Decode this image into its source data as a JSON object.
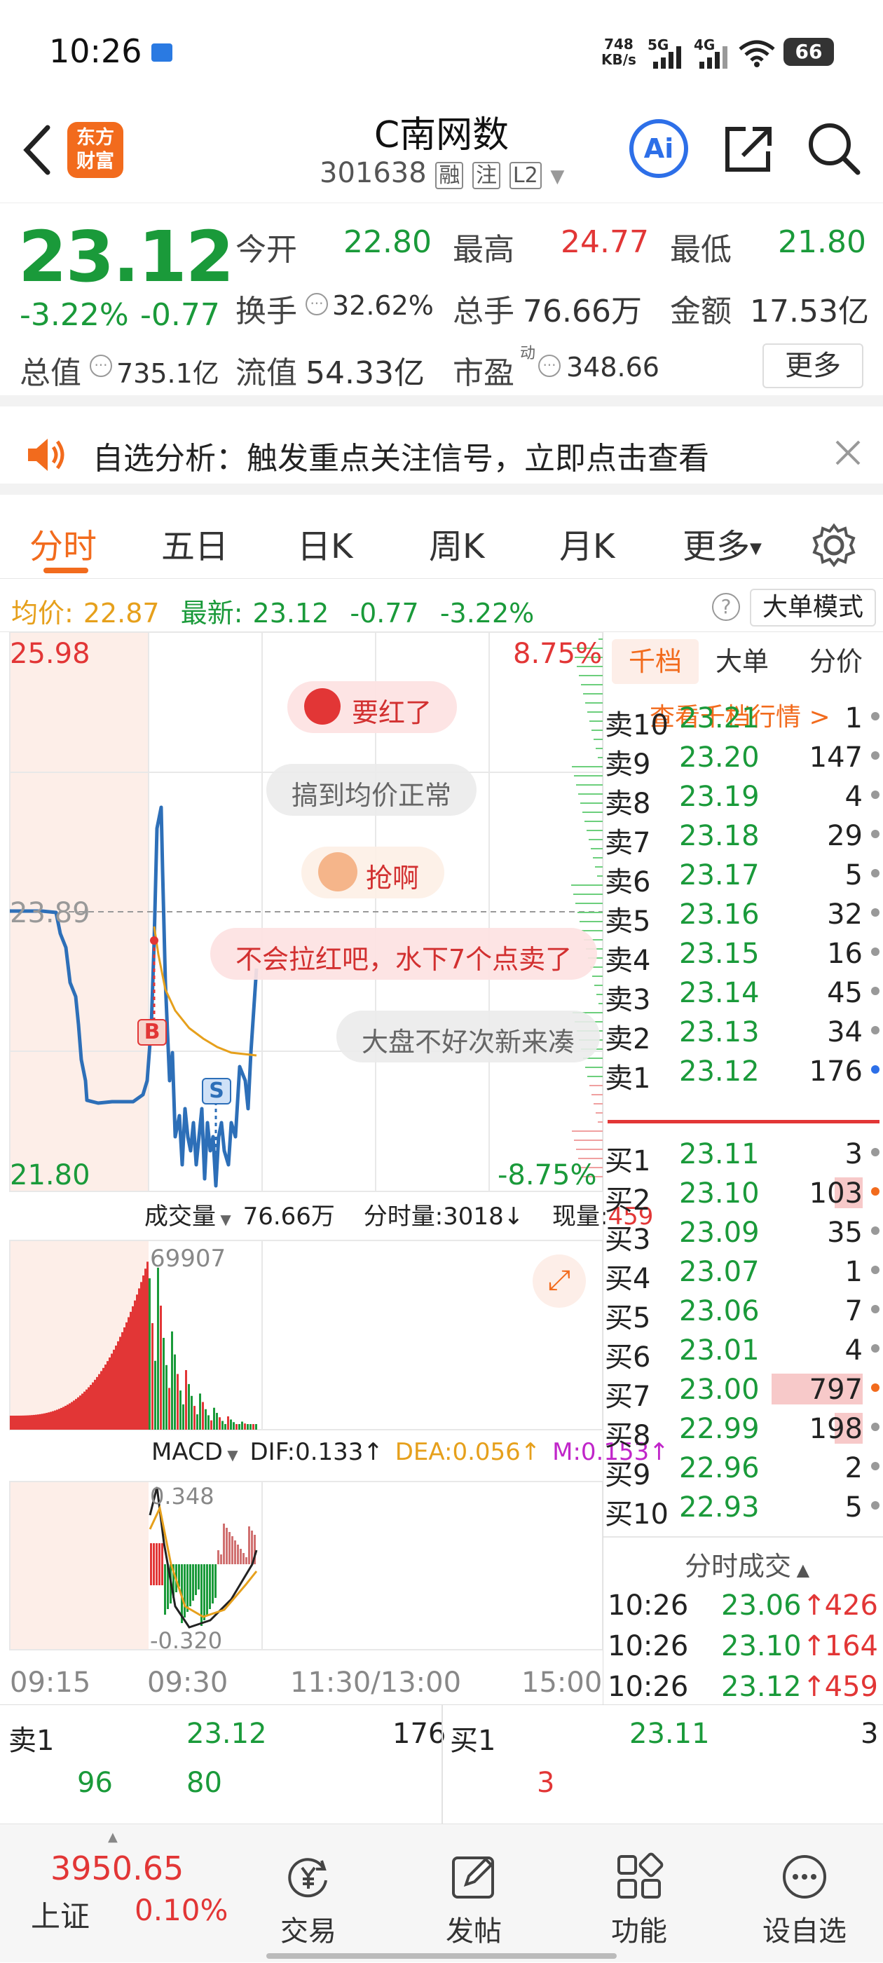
{
  "status": {
    "time": "10:26",
    "net_speed": "748",
    "net_unit": "KB/s",
    "battery": "66"
  },
  "header": {
    "logo_line1": "东方",
    "logo_line2": "财富",
    "title": "C南网数",
    "code": "301638",
    "badges": [
      "融",
      "注",
      "L2"
    ],
    "ai_label": "Ai"
  },
  "quote": {
    "price": "23.12",
    "change_pct": "-3.22%",
    "change": "-0.77",
    "open_label": "今开",
    "open": "22.80",
    "high_label": "最高",
    "high": "24.77",
    "low_label": "最低",
    "low": "21.80",
    "turnover_label": "换手",
    "turnover": "32.62%",
    "volume_label": "总手",
    "volume": "76.66万",
    "amount_label": "金额",
    "amount": "17.53亿",
    "mktcap_label": "总值",
    "mktcap": "735.1亿",
    "float_label": "流值",
    "float": "54.33亿",
    "pe_label": "市盈",
    "pe_sup": "动",
    "pe": "348.66",
    "more_button": "更多"
  },
  "notice": {
    "text": "自选分析：触发重点关注信号，立即点击查看"
  },
  "tabs": [
    "分时",
    "五日",
    "日K",
    "周K",
    "月K",
    "更多"
  ],
  "avgbar": {
    "avg_label": "均价:",
    "avg": "22.87",
    "latest_label": "最新:",
    "latest": "23.12",
    "chg": "-0.77",
    "pct": "-3.22%",
    "mode_button": "大单模式"
  },
  "chart": {
    "top_price": "25.98",
    "mid_price": "23.89",
    "bottom_price": "21.80",
    "top_pct": "8.75%",
    "bottom_pct": "-8.75%",
    "vol_label": "成交量",
    "vol_total": "76.66万",
    "vol_time": "分时量:3018↓",
    "vol_now_label": "现量:",
    "vol_now": "459",
    "vol_max": "69907",
    "macd_label": "MACD",
    "dif": "DIF:0.133↑",
    "dea": "DEA:0.056↑",
    "m": "M:0.153↑",
    "macd_max": "0.348",
    "macd_min": "-0.320",
    "time_labels": [
      "09:15",
      "09:30",
      "11:30/13:00",
      "15:00"
    ],
    "marker_b": "B",
    "marker_s": "S"
  },
  "comments": [
    "要红了",
    "搞到均价正常",
    "抢啊",
    "不会拉红吧，水下7个点卖了",
    "大盘不好次新来凑"
  ],
  "orderbook": {
    "tabs": [
      "千档",
      "大单",
      "分价"
    ],
    "link": "查看千档行情 >",
    "sell": [
      {
        "label": "卖10",
        "price": "23.21",
        "qty": "1"
      },
      {
        "label": "卖9",
        "price": "23.20",
        "qty": "147"
      },
      {
        "label": "卖8",
        "price": "23.19",
        "qty": "4"
      },
      {
        "label": "卖7",
        "price": "23.18",
        "qty": "29"
      },
      {
        "label": "卖6",
        "price": "23.17",
        "qty": "5"
      },
      {
        "label": "卖5",
        "price": "23.16",
        "qty": "32"
      },
      {
        "label": "卖4",
        "price": "23.15",
        "qty": "16"
      },
      {
        "label": "卖3",
        "price": "23.14",
        "qty": "45"
      },
      {
        "label": "卖2",
        "price": "23.13",
        "qty": "34"
      },
      {
        "label": "卖1",
        "price": "23.12",
        "qty": "176"
      }
    ],
    "buy": [
      {
        "label": "买1",
        "price": "23.11",
        "qty": "3"
      },
      {
        "label": "买2",
        "price": "23.10",
        "qty": "103"
      },
      {
        "label": "买3",
        "price": "23.09",
        "qty": "35"
      },
      {
        "label": "买4",
        "price": "23.07",
        "qty": "1"
      },
      {
        "label": "买5",
        "price": "23.06",
        "qty": "7"
      },
      {
        "label": "买6",
        "price": "23.01",
        "qty": "4"
      },
      {
        "label": "买7",
        "price": "23.00",
        "qty": "797"
      },
      {
        "label": "买8",
        "price": "22.99",
        "qty": "198"
      },
      {
        "label": "买9",
        "price": "22.96",
        "qty": "2"
      },
      {
        "label": "买10",
        "price": "22.93",
        "qty": "5"
      }
    ],
    "trades_title": "分时成交",
    "trades": [
      {
        "time": "10:26",
        "price": "23.06",
        "qty": "426"
      },
      {
        "time": "10:26",
        "price": "23.10",
        "qty": "164"
      },
      {
        "time": "10:26",
        "price": "23.12",
        "qty": "459"
      }
    ]
  },
  "bottombook": {
    "sell_label": "卖1",
    "sell_price": "23.12",
    "sell_qty": "176",
    "buy_label": "买1",
    "buy_price": "23.11",
    "buy_qty": "3",
    "sub_left": "96",
    "sub_mid": "80",
    "sub_right": "3"
  },
  "bottomnav": {
    "index_value": "3950.65",
    "index_name": "上证",
    "index_pct": "0.10%",
    "items": [
      "交易",
      "发帖",
      "功能",
      "设自选"
    ]
  }
}
